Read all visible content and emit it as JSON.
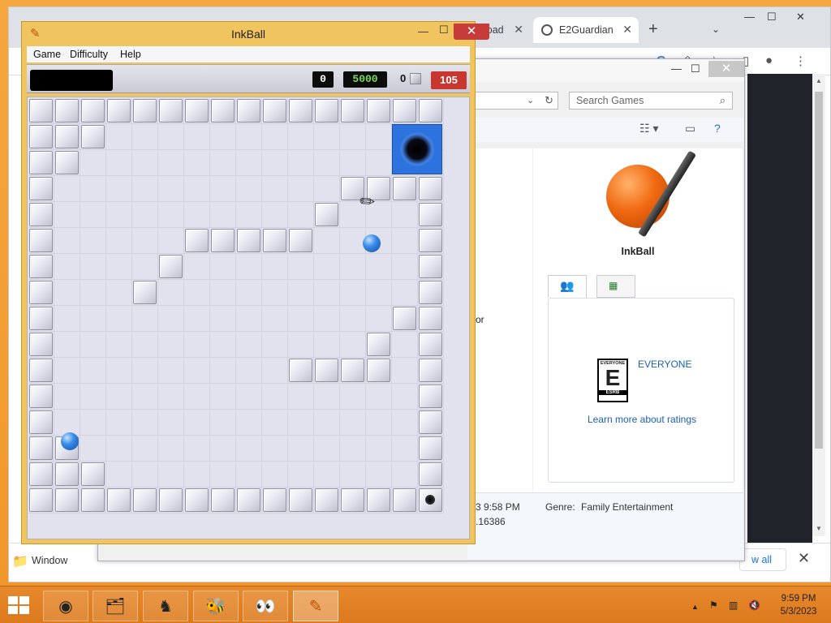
{
  "chrome": {
    "tabs": [
      {
        "label": "wnload"
      },
      {
        "label": "E2Guardian"
      }
    ],
    "new_tab": "+",
    "download_item": "Window",
    "show_all": "w all"
  },
  "explorer": {
    "search_placeholder": "Search Games",
    "left_partial": "or",
    "game_name": "InkBall",
    "rating_text": "EVERYONE",
    "learn_more": "Learn more about ratings",
    "details": {
      "played_partial": "3 9:58 PM",
      "version_partial": ".16386",
      "genre_label": "Genre:",
      "genre_value": "Family Entertainment"
    }
  },
  "inkball": {
    "title": "InkBall",
    "menu": [
      "Game",
      "Difficulty",
      "Help"
    ],
    "score": {
      "current": "0",
      "goal": "5000",
      "count": "0",
      "time": "105"
    }
  },
  "taskbar": {
    "time": "9:59 PM",
    "date": "5/3/2023"
  },
  "colors": {
    "desktop": "#f0982b",
    "inkball_frame": "#f0c45e",
    "close_red": "#c83b3b",
    "goal_green": "#7ed957",
    "ball_blue": "#2d73e0"
  }
}
